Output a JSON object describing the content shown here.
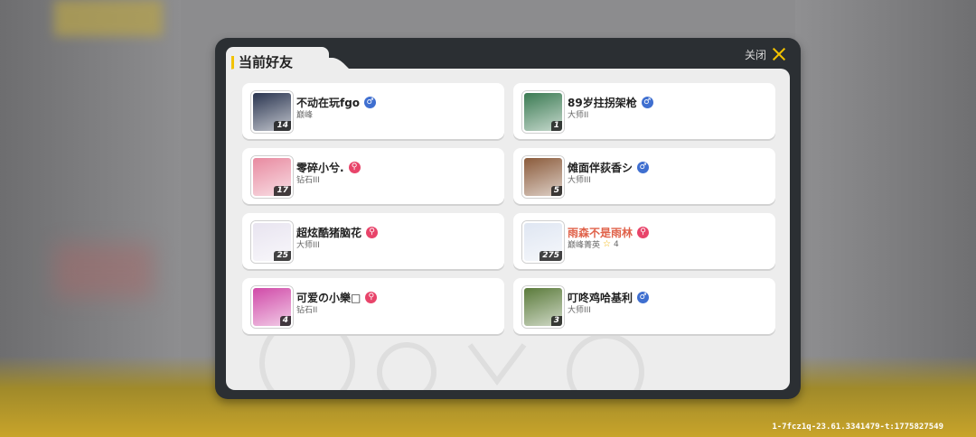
{
  "dialog": {
    "title": "当前好友",
    "close_label": "关闭"
  },
  "friends": [
    {
      "name": "不动在玩fgo",
      "rank": "巅峰",
      "gender": "male",
      "gender_icon": "♂",
      "level": "14",
      "avatar_color": "#2a3550"
    },
    {
      "name": "89岁拄拐架枪",
      "rank": "大师II",
      "gender": "male",
      "gender_icon": "♂",
      "level": "1",
      "avatar_color": "#3a7a52"
    },
    {
      "name": "零碎小兮.",
      "rank": "钻石III",
      "gender": "female",
      "gender_icon": "⚲",
      "level": "17",
      "avatar_color": "#e88aa0"
    },
    {
      "name": "傩面伴荻香シ",
      "rank": "大师III",
      "gender": "male",
      "gender_icon": "♂",
      "level": "5",
      "avatar_color": "#8a5a3a"
    },
    {
      "name": "超炫酷猪脑花",
      "rank": "大师III",
      "gender": "female",
      "gender_icon": "⚲",
      "level": "25",
      "avatar_color": "#e8e4f0"
    },
    {
      "name": "雨森不是雨林",
      "rank": "巅峰菁英",
      "gender": "female",
      "gender_icon": "⚲",
      "level": "275",
      "avatar_color": "#dfe6f2",
      "star_count": "4",
      "highlight": true
    },
    {
      "name": "可爱の小樂□",
      "rank": "钻石II",
      "gender": "female",
      "gender_icon": "⚲",
      "level": "4",
      "avatar_color": "#d04aa8"
    },
    {
      "name": "叮咚鸡哈基利",
      "rank": "大师III",
      "gender": "male",
      "gender_icon": "♂",
      "level": "3",
      "avatar_color": "#5a7a3a"
    }
  ],
  "watermark": "1-7fcz1q-23.61.3341479-t:1775827549",
  "colors": {
    "accent": "#f2c200",
    "male": "#3f6fd0",
    "female": "#e8446a",
    "highlight_name": "#e0624a"
  }
}
